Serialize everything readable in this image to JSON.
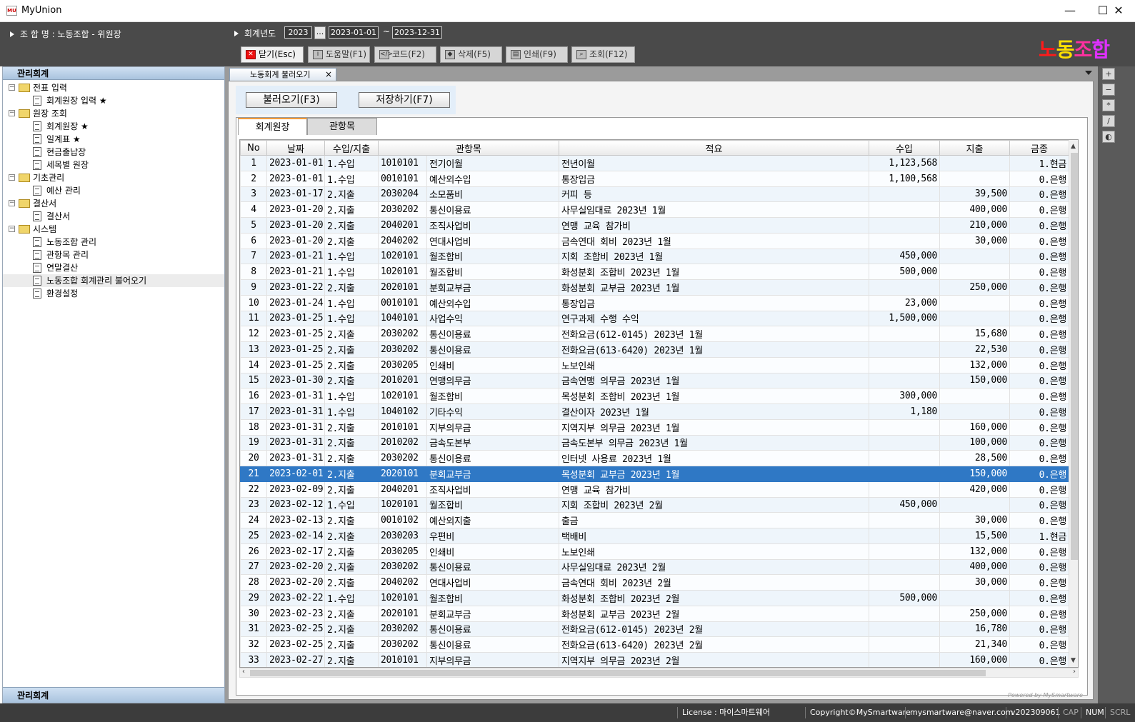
{
  "window": {
    "title": "MyUnion",
    "app_icon_text": "MU",
    "minimize": "—",
    "maximize": "☐",
    "close": "✕"
  },
  "header": {
    "union_label": "조 합 명 : 노동조합 - 위원장",
    "fiscal_label": "회계년도",
    "year": "2023",
    "date_from": "2023-01-01",
    "date_to": "2023-12-31",
    "dots": "...",
    "tilde": "~"
  },
  "toolbar": {
    "close": "닫기(Esc)",
    "help": "도움말(F1)",
    "code": "코드(F2)",
    "delete": "삭제(F5)",
    "print": "인쇄(F9)",
    "search": "조회(F12)"
  },
  "brand": {
    "c1": "노",
    "c2": "동",
    "c3": "조",
    "c4": "합"
  },
  "sidebar": {
    "header": "관리회계",
    "footer": "관리회계",
    "tree": [
      {
        "label": "전표 입력",
        "level": 0,
        "type": "folder"
      },
      {
        "label": "회계원장 입력 ★",
        "level": 1,
        "type": "doc"
      },
      {
        "label": "원장 조회",
        "level": 0,
        "type": "folder"
      },
      {
        "label": "회계원장 ★",
        "level": 1,
        "type": "doc"
      },
      {
        "label": "일계표 ★",
        "level": 1,
        "type": "doc"
      },
      {
        "label": "현금출납장",
        "level": 1,
        "type": "doc"
      },
      {
        "label": "세목별 원장",
        "level": 1,
        "type": "doc"
      },
      {
        "label": "기초관리",
        "level": 0,
        "type": "folder"
      },
      {
        "label": "예산 관리",
        "level": 1,
        "type": "doc"
      },
      {
        "label": "결산서",
        "level": 0,
        "type": "folder"
      },
      {
        "label": "결산서",
        "level": 1,
        "type": "doc"
      },
      {
        "label": "시스템",
        "level": 0,
        "type": "folder"
      },
      {
        "label": "노동조합 관리",
        "level": 1,
        "type": "doc"
      },
      {
        "label": "관항목 관리",
        "level": 1,
        "type": "doc"
      },
      {
        "label": "연말결산",
        "level": 1,
        "type": "doc"
      },
      {
        "label": "노동조합 회계관리 불어오기",
        "level": 1,
        "type": "doc",
        "selected": true
      },
      {
        "label": "환경설정",
        "level": 1,
        "type": "doc"
      }
    ]
  },
  "main": {
    "doc_tab": "노동회계 불러오기",
    "doc_tab_close": "×",
    "load_button": "불러오기(F3)",
    "save_button": "저장하기(F7)",
    "subtabs": [
      "회계원장",
      "관항목"
    ],
    "columns": [
      "No",
      "날짜",
      "수입/지출",
      "관항목",
      "적요",
      "수입",
      "지출",
      "금종"
    ],
    "rows": [
      [
        "1",
        "2023-01-01",
        "1.수입",
        "1010101",
        "전기이월",
        "전년이월",
        "1,123,568",
        "",
        "1.현금"
      ],
      [
        "2",
        "2023-01-01",
        "1.수입",
        "0010101",
        "예산외수입",
        "통장입금",
        "1,100,568",
        "",
        "0.은행"
      ],
      [
        "3",
        "2023-01-17",
        "2.지출",
        "2030204",
        "소모품비",
        "커피 등",
        "",
        "39,500",
        "0.은행"
      ],
      [
        "4",
        "2023-01-20",
        "2.지출",
        "2030202",
        "통신이용료",
        "사무실임대료 2023년 1월",
        "",
        "400,000",
        "0.은행"
      ],
      [
        "5",
        "2023-01-20",
        "2.지출",
        "2040201",
        "조직사업비",
        "연맹 교육 참가비",
        "",
        "210,000",
        "0.은행"
      ],
      [
        "6",
        "2023-01-20",
        "2.지출",
        "2040202",
        "연대사업비",
        "금속연대 회비 2023년 1월",
        "",
        "30,000",
        "0.은행"
      ],
      [
        "7",
        "2023-01-21",
        "1.수입",
        "1020101",
        "월조합비",
        "지회 조합비 2023년 1월",
        "450,000",
        "",
        "0.은행"
      ],
      [
        "8",
        "2023-01-21",
        "1.수입",
        "1020101",
        "월조합비",
        "화성분회 조합비 2023년 1월",
        "500,000",
        "",
        "0.은행"
      ],
      [
        "9",
        "2023-01-22",
        "2.지출",
        "2020101",
        "분회교부금",
        "화성분회 교부금 2023년 1월",
        "",
        "250,000",
        "0.은행"
      ],
      [
        "10",
        "2023-01-24",
        "1.수입",
        "0010101",
        "예산외수입",
        "통장입금",
        "23,000",
        "",
        "0.은행"
      ],
      [
        "11",
        "2023-01-25",
        "1.수입",
        "1040101",
        "사업수익",
        "연구과제 수행 수익",
        "1,500,000",
        "",
        "0.은행"
      ],
      [
        "12",
        "2023-01-25",
        "2.지출",
        "2030202",
        "통신이용료",
        "전화요금(612-0145) 2023년 1월",
        "",
        "15,680",
        "0.은행"
      ],
      [
        "13",
        "2023-01-25",
        "2.지출",
        "2030202",
        "통신이용료",
        "전화요금(613-6420) 2023년 1월",
        "",
        "22,530",
        "0.은행"
      ],
      [
        "14",
        "2023-01-25",
        "2.지출",
        "2030205",
        "인쇄비",
        "노보인쇄",
        "",
        "132,000",
        "0.은행"
      ],
      [
        "15",
        "2023-01-30",
        "2.지출",
        "2010201",
        "연맹의무금",
        "금속연맹 의무금 2023년 1월",
        "",
        "150,000",
        "0.은행"
      ],
      [
        "16",
        "2023-01-31",
        "1.수입",
        "1020101",
        "월조합비",
        "목성분회 조합비 2023년 1월",
        "300,000",
        "",
        "0.은행"
      ],
      [
        "17",
        "2023-01-31",
        "1.수입",
        "1040102",
        "기타수익",
        "결산이자 2023년 1월",
        "1,180",
        "",
        "0.은행"
      ],
      [
        "18",
        "2023-01-31",
        "2.지출",
        "2010101",
        "지부의무금",
        "지역지부 의무금 2023년 1월",
        "",
        "160,000",
        "0.은행"
      ],
      [
        "19",
        "2023-01-31",
        "2.지출",
        "2010202",
        "금속도본부",
        "금속도본부 의무금 2023년 1월",
        "",
        "100,000",
        "0.은행"
      ],
      [
        "20",
        "2023-01-31",
        "2.지출",
        "2030202",
        "통신이용료",
        "인터넷 사용료 2023년 1월",
        "",
        "28,500",
        "0.은행"
      ],
      [
        "21",
        "2023-02-01",
        "2.지출",
        "2020101",
        "분회교부금",
        "목성분회 교부금 2023년 1월",
        "",
        "150,000",
        "0.은행"
      ],
      [
        "22",
        "2023-02-09",
        "2.지출",
        "2040201",
        "조직사업비",
        "연맹 교육 참가비",
        "",
        "420,000",
        "0.은행"
      ],
      [
        "23",
        "2023-02-12",
        "1.수입",
        "1020101",
        "월조합비",
        "지회 조합비 2023년 2월",
        "450,000",
        "",
        "0.은행"
      ],
      [
        "24",
        "2023-02-13",
        "2.지출",
        "0010102",
        "예산외지출",
        "출금",
        "",
        "30,000",
        "0.은행"
      ],
      [
        "25",
        "2023-02-14",
        "2.지출",
        "2030203",
        "우편비",
        "택배비",
        "",
        "15,500",
        "1.현금"
      ],
      [
        "26",
        "2023-02-17",
        "2.지출",
        "2030205",
        "인쇄비",
        "노보인쇄",
        "",
        "132,000",
        "0.은행"
      ],
      [
        "27",
        "2023-02-20",
        "2.지출",
        "2030202",
        "통신이용료",
        "사무실임대료 2023년 2월",
        "",
        "400,000",
        "0.은행"
      ],
      [
        "28",
        "2023-02-20",
        "2.지출",
        "2040202",
        "연대사업비",
        "금속연대 회비 2023년 2월",
        "",
        "30,000",
        "0.은행"
      ],
      [
        "29",
        "2023-02-22",
        "1.수입",
        "1020101",
        "월조합비",
        "화성분회 조합비 2023년 2월",
        "500,000",
        "",
        "0.은행"
      ],
      [
        "30",
        "2023-02-23",
        "2.지출",
        "2020101",
        "분회교부금",
        "화성분회 교부금 2023년 2월",
        "",
        "250,000",
        "0.은행"
      ],
      [
        "31",
        "2023-02-25",
        "2.지출",
        "2030202",
        "통신이용료",
        "전화요금(612-0145) 2023년 2월",
        "",
        "16,780",
        "0.은행"
      ],
      [
        "32",
        "2023-02-25",
        "2.지출",
        "2030202",
        "통신이용료",
        "전화요금(613-6420) 2023년 2월",
        "",
        "21,340",
        "0.은행"
      ],
      [
        "33",
        "2023-02-27",
        "2.지출",
        "2010101",
        "지부의무금",
        "지역지부 의무금 2023년 2월",
        "",
        "160,000",
        "0.은행"
      ]
    ],
    "selected_row": 21,
    "powered": "Powered by MySmartware"
  },
  "right_strip": [
    "+",
    "−",
    "*",
    "/",
    "◐"
  ],
  "status": {
    "license": "License : 마이스마트웨어",
    "copyright": "Copyright©MySmartware",
    "email": "mysmartware@naver.com",
    "version": "v202309061",
    "cap": "CAP",
    "num": "NUM",
    "scrl": "SCRL"
  }
}
